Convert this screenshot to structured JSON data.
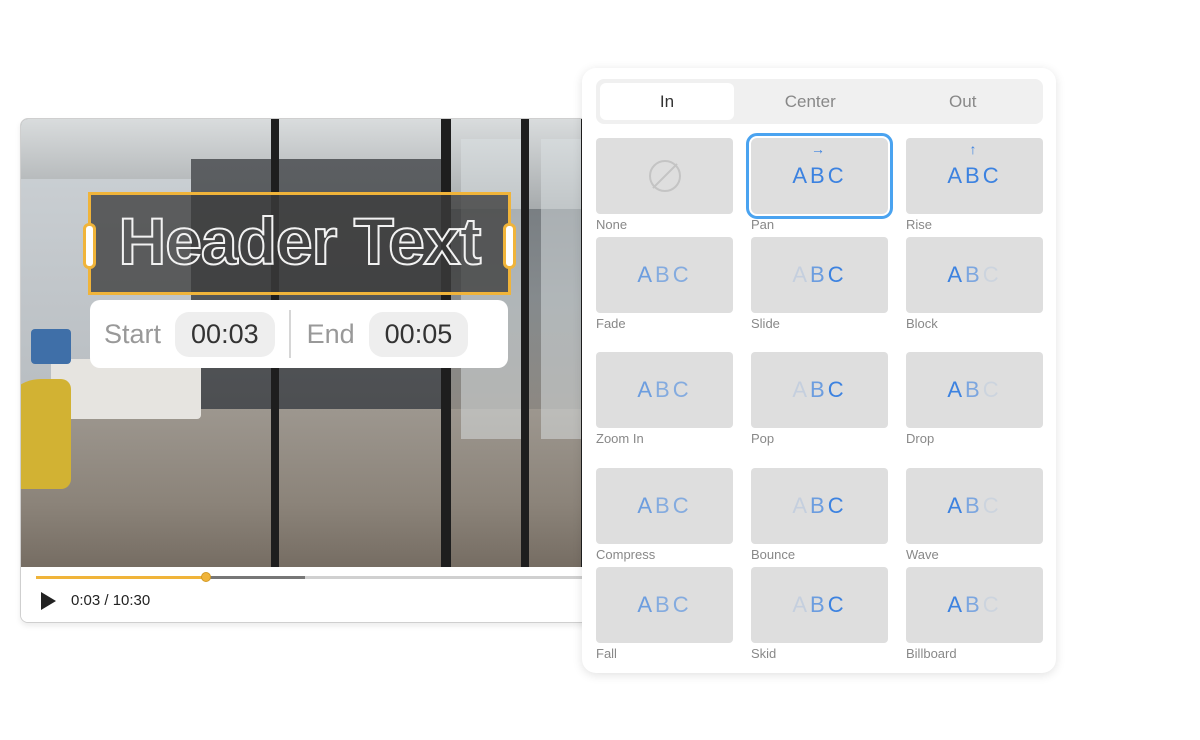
{
  "player": {
    "caption": {
      "text": "Header Text",
      "start_label": "Start",
      "start_value": "00:03",
      "end_label": "End",
      "end_value": "00:05"
    },
    "controls": {
      "time_readout": "0:03 / 10:30",
      "played_fraction": 0.31,
      "buffered_fraction": 0.49
    },
    "accent_color": "#f0b43a"
  },
  "panel": {
    "tabs": [
      {
        "label": "In",
        "active": true
      },
      {
        "label": "Center",
        "active": false
      },
      {
        "label": "Out",
        "active": false
      }
    ],
    "preview_text": [
      "A",
      "B",
      "C"
    ],
    "selected": "Pan",
    "accent_color": "#3c82e0",
    "animations": [
      {
        "label": "None",
        "icon": "none-icon"
      },
      {
        "label": "Pan",
        "arrow": "→"
      },
      {
        "label": "Rise",
        "arrow": "↑"
      },
      {
        "label": "Fade"
      },
      {
        "label": "Slide"
      },
      {
        "label": "Block"
      },
      {
        "label": "Zoom In"
      },
      {
        "label": "Pop"
      },
      {
        "label": "Drop"
      },
      {
        "label": "Compress"
      },
      {
        "label": "Bounce"
      },
      {
        "label": "Wave"
      },
      {
        "label": "Fall"
      },
      {
        "label": "Skid"
      },
      {
        "label": "Billboard"
      }
    ]
  }
}
